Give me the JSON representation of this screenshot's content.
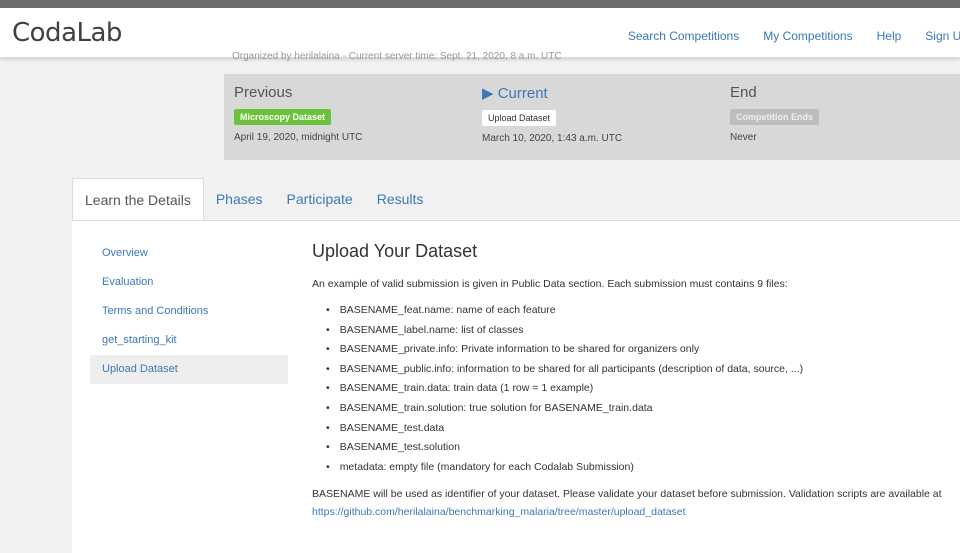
{
  "app": {
    "logo": "CodaLab",
    "nav": [
      "Search Competitions",
      "My Competitions",
      "Help",
      "Sign Up"
    ]
  },
  "header": {
    "organized": "Organized by herilalaina - Current server time: Sept. 21, 2020, 8 a.m. UTC"
  },
  "phases": {
    "previous": {
      "title": "Previous",
      "badge": "Microscopy Dataset",
      "date": "April 19, 2020, midnight UTC"
    },
    "current": {
      "title": "▶ Current",
      "badge": "Upload Dataset",
      "date": "March 10, 2020, 1:43 a.m. UTC"
    },
    "end": {
      "title": "End",
      "badge": "Competition Ends",
      "date": "Never"
    }
  },
  "tabs": [
    "Learn the Details",
    "Phases",
    "Participate",
    "Results"
  ],
  "sidenav": [
    "Overview",
    "Evaluation",
    "Terms and Conditions",
    "get_starting_kit",
    "Upload Dataset"
  ],
  "main": {
    "title": "Upload Your Dataset",
    "intro": "An example of valid submission is given in Public Data section. Each submission must contains 9 files:",
    "files": [
      "BASENAME_feat.name: name of each feature",
      "BASENAME_label.name: list of classes",
      "BASENAME_private.info: Private information to be shared for organizers only",
      "BASENAME_public.info: information to be shared for all participants (description of data, source, ...)",
      "BASENAME_train.data: train data (1 row = 1 example)",
      "BASENAME_train.solution: true solution for BASENAME_train.data",
      "BASENAME_test.data",
      "BASENAME_test.solution",
      "metadata: empty file (mandatory for each Codalab Submission)"
    ],
    "outro_text": "BASENAME will be used as identifier of your dataset. Please validate your dataset before submission. Validation scripts are available at ",
    "outro_link": "https://github.com/herilalaina/benchmarking_malaria/tree/master/upload_dataset"
  },
  "colors": {
    "link": "#3a78b8",
    "badge_green": "#6cc33b",
    "panel": "#d8d8d8"
  }
}
